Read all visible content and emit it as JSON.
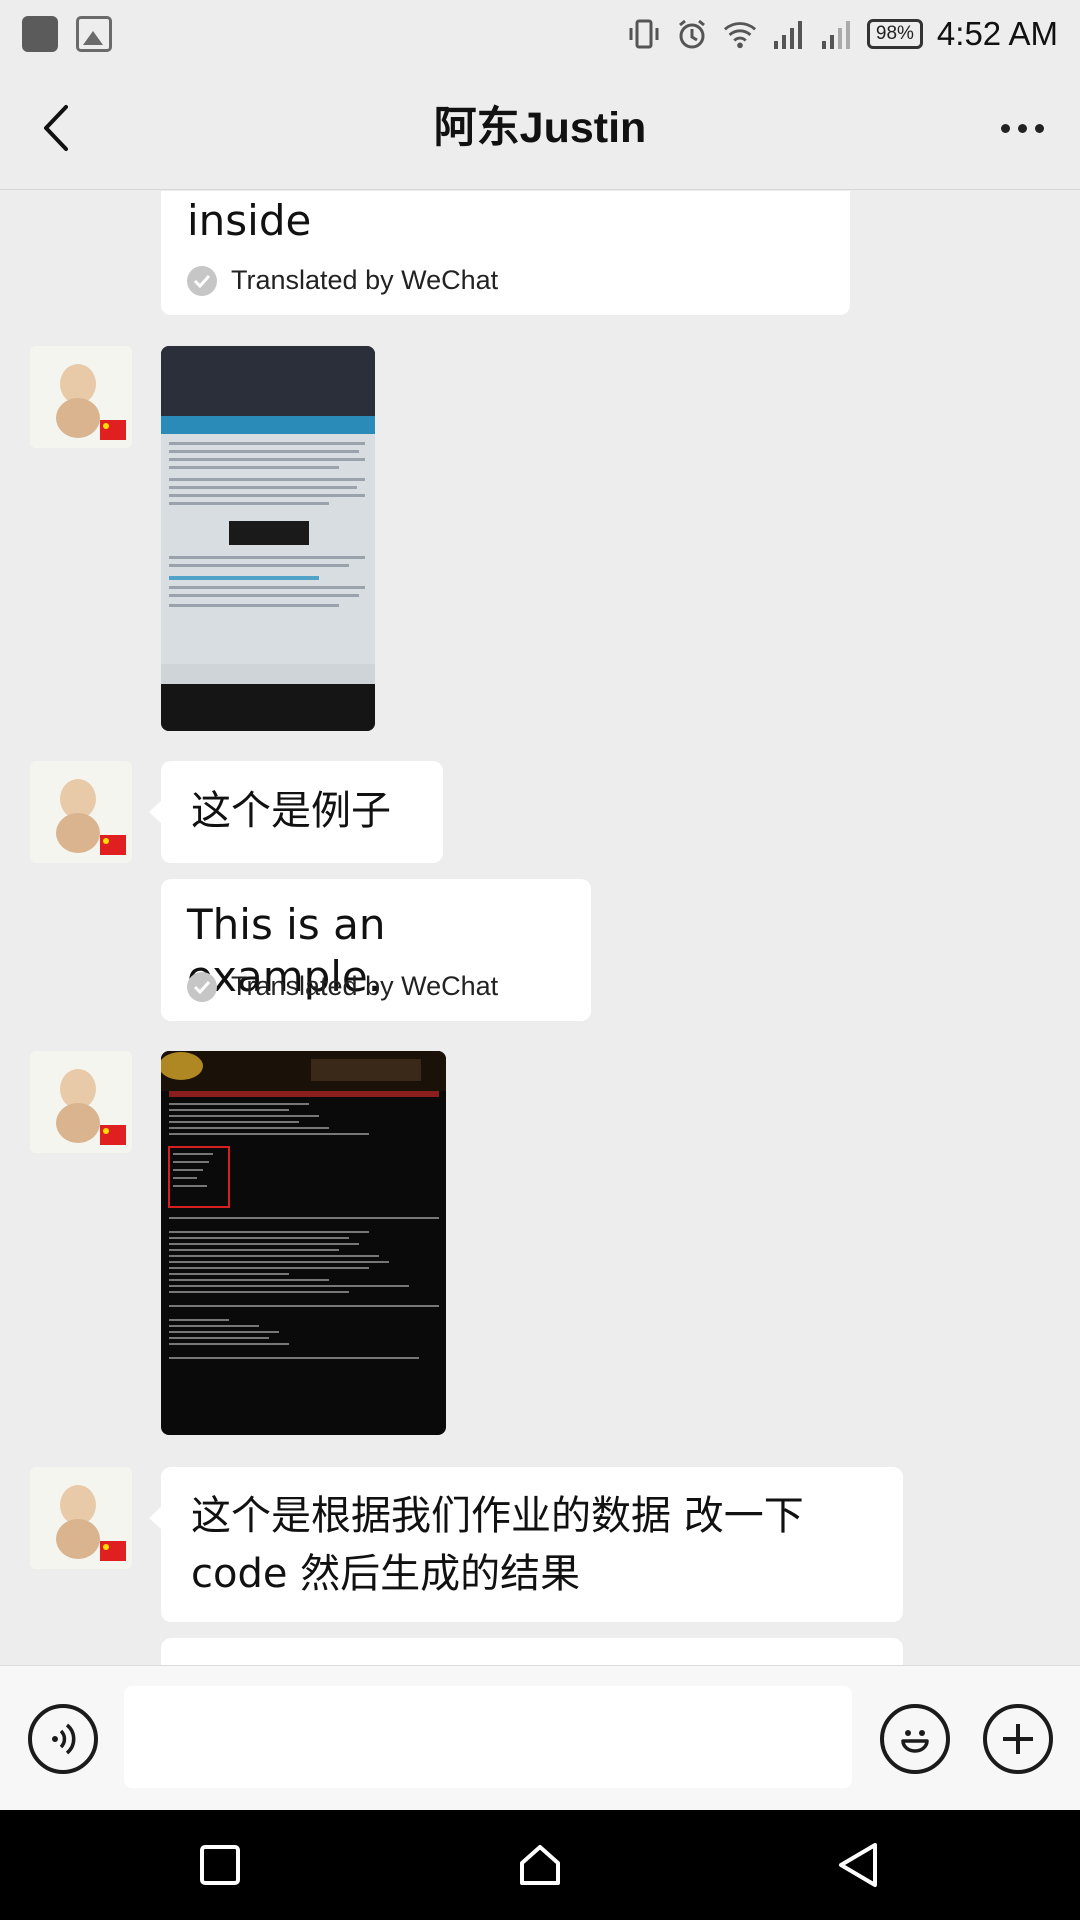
{
  "status_bar": {
    "battery": "98%",
    "time": "4:52 AM"
  },
  "header": {
    "title": "阿东Justin"
  },
  "messages": [
    {
      "type": "translation",
      "text": "inside",
      "translated_by": "Translated by WeChat"
    },
    {
      "type": "image",
      "description": "photo of a tablet showing Tutorial 3.pdf"
    },
    {
      "type": "text",
      "text": "这个是例子"
    },
    {
      "type": "translation",
      "text": "This is an example.",
      "translated_by": "Translated by WeChat"
    },
    {
      "type": "image",
      "description": "photo of a terminal window output"
    },
    {
      "type": "text",
      "text_line1": "这个是根据我们作业的数据 改一下",
      "text_line2": "code 然后生成的结果"
    }
  ],
  "icons": {
    "back": "back-arrow-icon",
    "more": "more-dots-icon",
    "voice": "voice-icon",
    "emoji": "emoji-icon",
    "plus": "plus-icon"
  },
  "colors": {
    "background": "#ededed",
    "bubble": "#ffffff",
    "nav_bar": "#000000"
  }
}
